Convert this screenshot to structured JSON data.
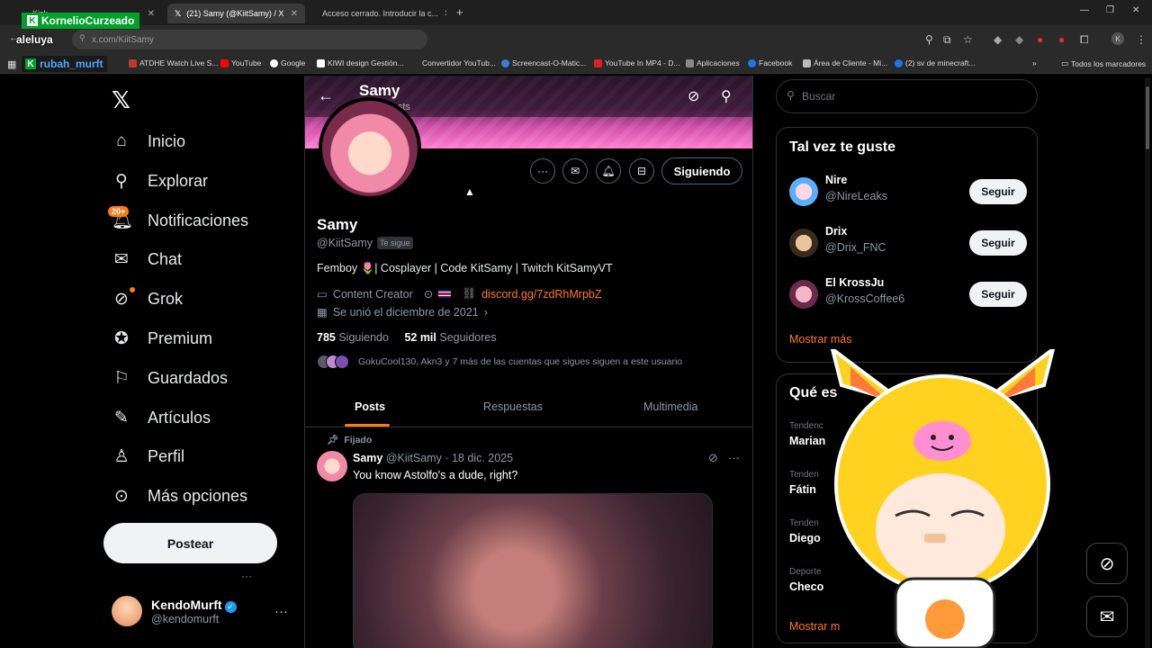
{
  "streamer": {
    "name": "KornelioCurzeado",
    "channel": "rubah_murft",
    "overlay_text": "aleluya"
  },
  "browser": {
    "tabs": [
      {
        "label": "Kick",
        "active": false
      },
      {
        "label": "(21) Samy (@KiitSamy) / X",
        "active": true
      },
      {
        "label": "Acceso cerrado. Introducir la c...",
        "active": false
      }
    ],
    "url": "x.com/KiitSamy",
    "bookmarks": [
      {
        "label": "ATDHE Watch Live S...",
        "color": "#c0392b"
      },
      {
        "label": "YouTube",
        "color": "#ff0000"
      },
      {
        "label": "Google",
        "color": "#ffffff"
      },
      {
        "label": "KIWI design Gestión...",
        "color": "#ffffff"
      },
      {
        "label": "Convertidor YouTub...",
        "color": "#2a2a2a"
      },
      {
        "label": "Screencast-O-Matic...",
        "color": "#3b7dd8"
      },
      {
        "label": "YouTube In MP4 - D...",
        "color": "#e02020"
      },
      {
        "label": "Aplicaciones",
        "color": "#888888"
      },
      {
        "label": "Facebook",
        "color": "#1877f2"
      },
      {
        "label": "Área de Cliente - Mi...",
        "color": "#bbbbbb"
      },
      {
        "label": "(2) sv de minecraft...",
        "color": "#1877f2"
      }
    ],
    "all_bookmarks": "Todos los marcadores"
  },
  "nav": {
    "items": [
      {
        "label": "Inicio",
        "icon": "home-icon"
      },
      {
        "label": "Explorar",
        "icon": "search-icon"
      },
      {
        "label": "Notificaciones",
        "icon": "bell-icon"
      },
      {
        "label": "Chat",
        "icon": "mail-icon"
      },
      {
        "label": "Grok",
        "icon": "grok-icon"
      },
      {
        "label": "Premium",
        "icon": "premium-icon"
      },
      {
        "label": "Guardados",
        "icon": "bookmark-icon"
      },
      {
        "label": "Artículos",
        "icon": "article-icon"
      },
      {
        "label": "Perfil",
        "icon": "person-icon"
      },
      {
        "label": "Más opciones",
        "icon": "more-icon"
      }
    ],
    "notif_count": "20+",
    "post_button": "Postear",
    "me": {
      "name": "KendoMurft",
      "handle": "@kendomurft"
    }
  },
  "profile": {
    "header_name": "Samy",
    "header_posts": "3.388 posts",
    "name": "Samy",
    "handle": "@KiitSamy",
    "follows_you": "Te sigue",
    "bio": "Femboy 🌷| Cosplayer | Code KitSamy | Twitch KitSamyVT",
    "category": "Content Creator",
    "link": "discord.gg/7zdRhMrpbZ",
    "joined": "Se unió el diciembre de 2021",
    "following_count": "785",
    "following_label": "Siguiendo",
    "followers_count": "52 mil",
    "followers_label": "Seguidores",
    "known_followers": "GokuCool130, Akn3 y 7 más de las cuentas que sigues siguen a este usuario",
    "follow_button": "Siguiendo"
  },
  "tabs": [
    "Posts",
    "Respuestas",
    "Multimedia"
  ],
  "pinned_post": {
    "pinned_label": "Fijado",
    "author": "Samy",
    "handle": "@KiitSamy",
    "date": "18 dic. 2025",
    "text": "You know Astolfo's a dude, right?"
  },
  "sidebar": {
    "search_placeholder": "Buscar",
    "suggestions_title": "Tal vez te guste",
    "suggestions": [
      {
        "name": "Nire",
        "handle": "@NireLeaks",
        "button": "Seguir"
      },
      {
        "name": "Drix",
        "handle": "@Drix_FNC",
        "button": "Seguir"
      },
      {
        "name": "El KrossJu",
        "handle": "@KrossCoffee6",
        "button": "Seguir"
      }
    ],
    "show_more": "Mostrar más",
    "trends_title": "Qué es",
    "trends": [
      {
        "category": "Tendenc",
        "name": "Marian"
      },
      {
        "category": "Tenden",
        "name": "Fátin"
      },
      {
        "category": "Tenden",
        "name": "Diego"
      },
      {
        "category": "Deporte",
        "name": "Checo"
      }
    ],
    "trends_more": "Mostrar m"
  },
  "colors": {
    "accent": "#ff7a1a",
    "background": "#000000",
    "border": "#2f3336",
    "muted": "#8b98a5"
  }
}
